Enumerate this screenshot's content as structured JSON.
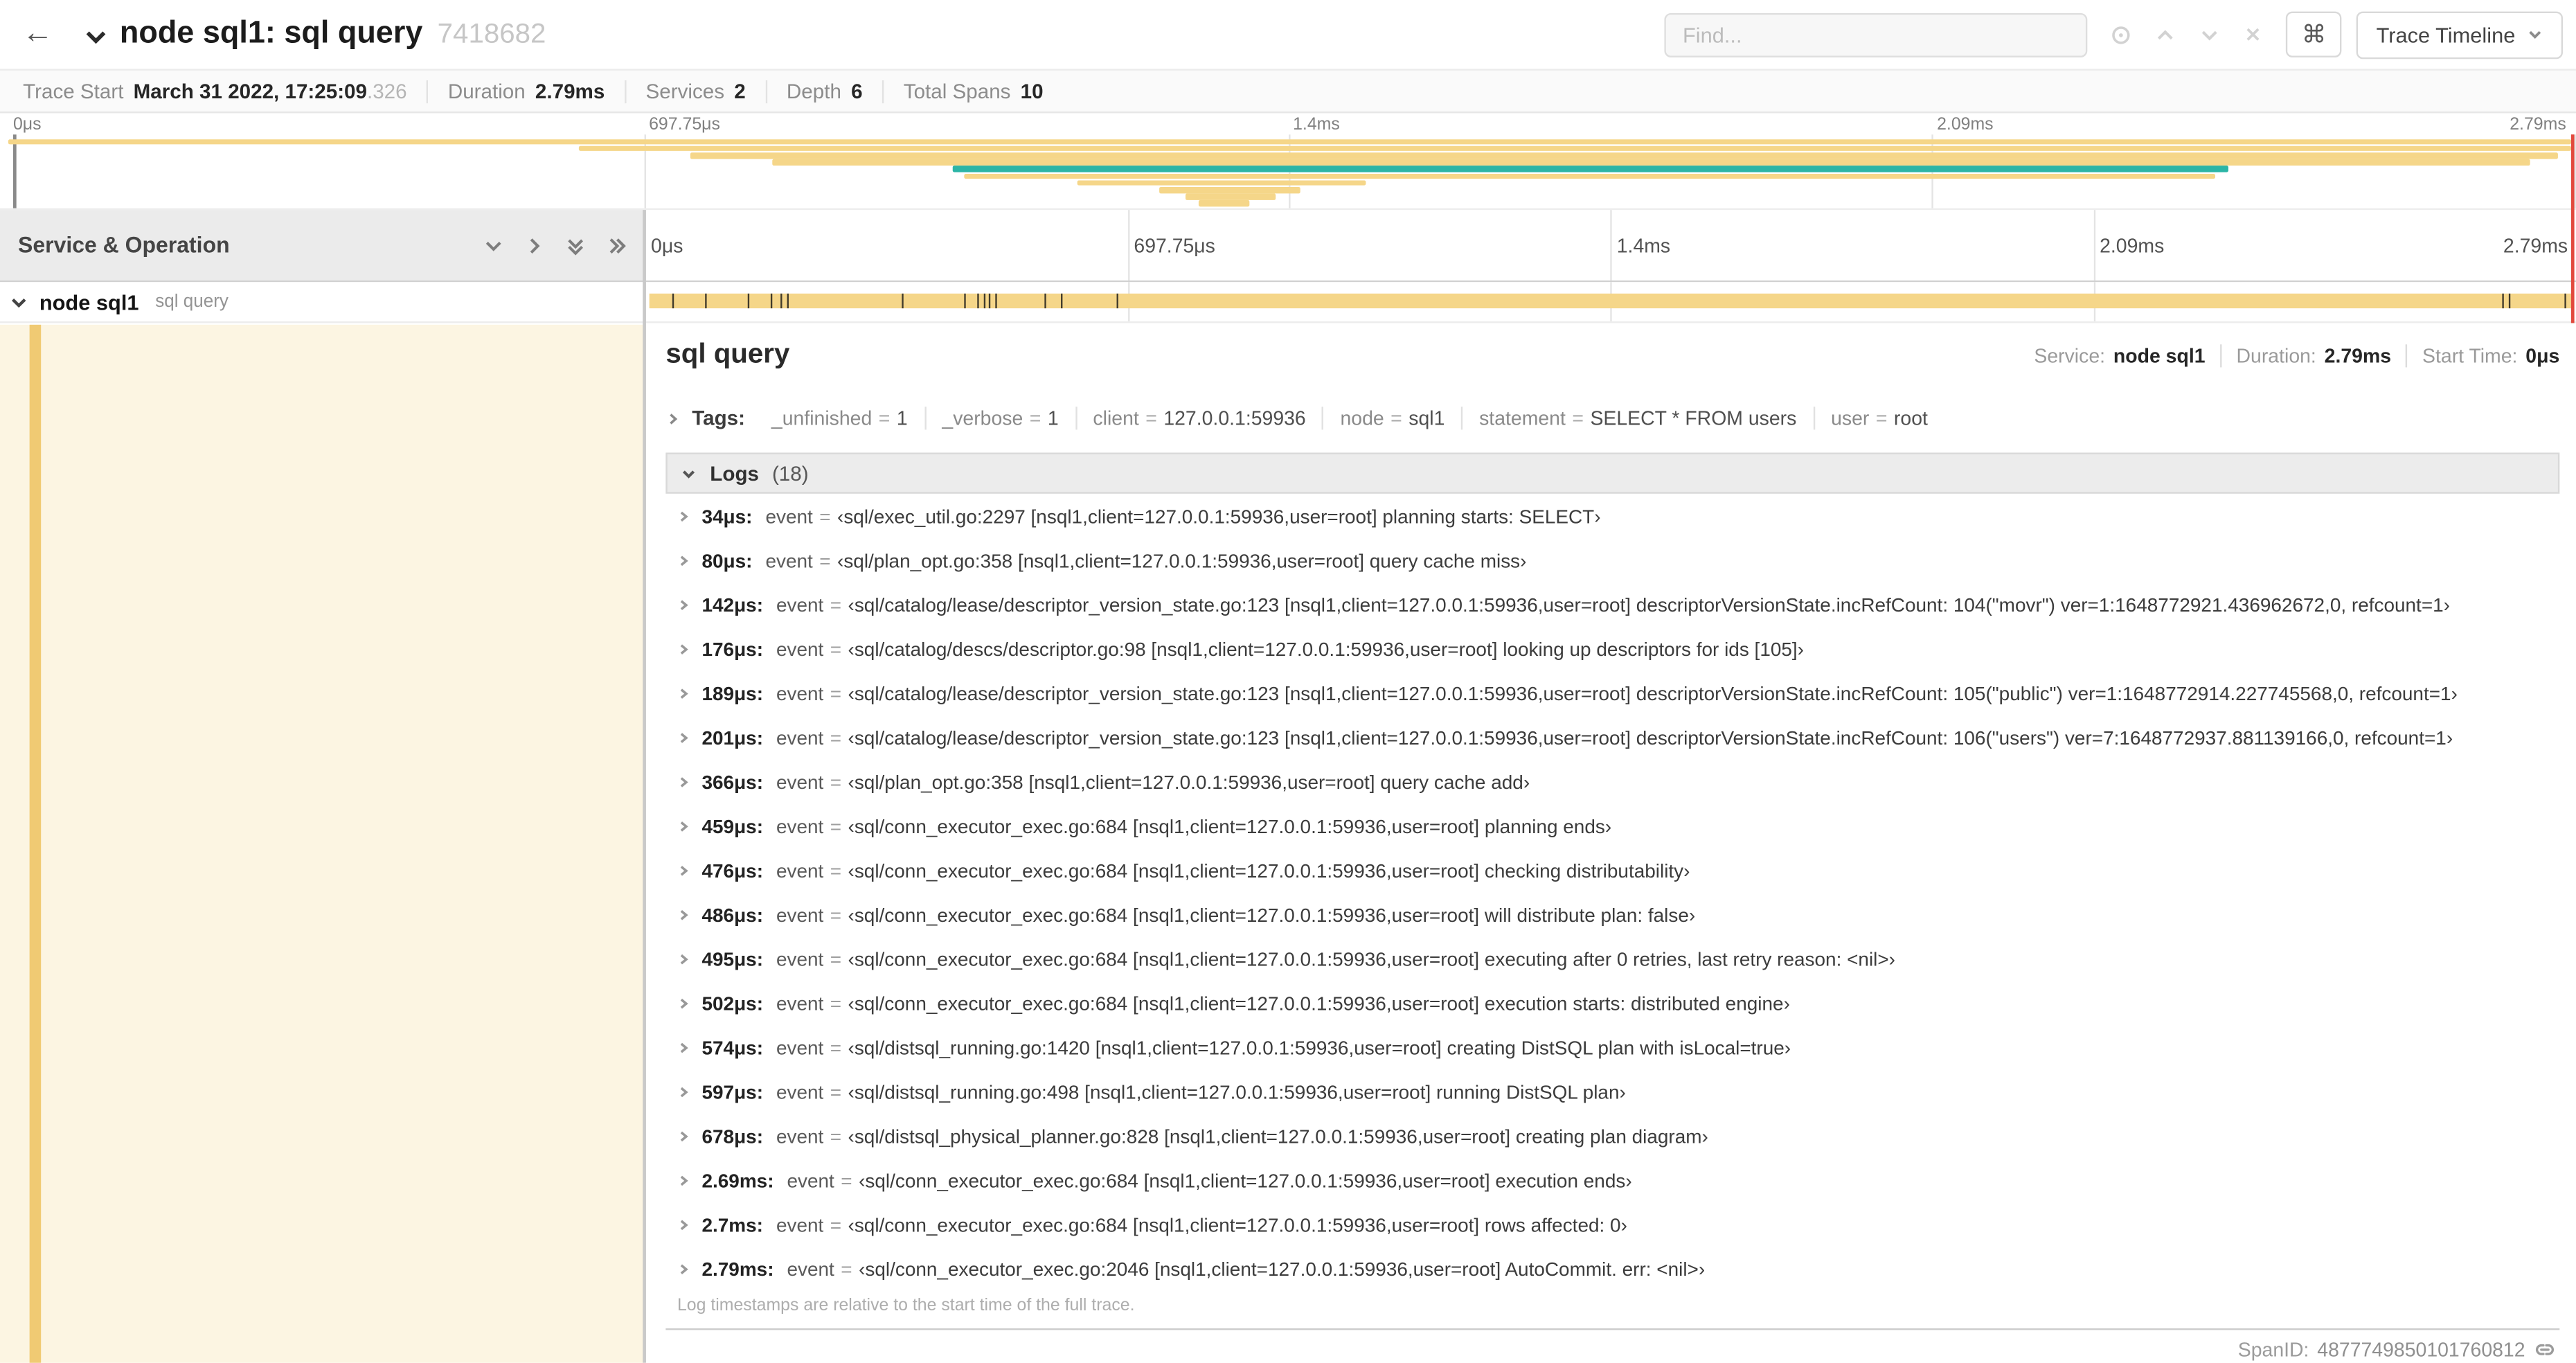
{
  "header": {
    "back_icon": "←",
    "title": "node sql1: sql query",
    "trace_id": "7418682",
    "find": {
      "placeholder": "Find..."
    },
    "shortcut_glyph": "⌘",
    "view_button": "Trace Timeline"
  },
  "summary": [
    {
      "label": "Trace Start",
      "value": "March 31 2022, 17:25:09",
      "suffix": ".326"
    },
    {
      "label": "Duration",
      "value": "2.79ms"
    },
    {
      "label": "Services",
      "value": "2"
    },
    {
      "label": "Depth",
      "value": "6"
    },
    {
      "label": "Total Spans",
      "value": "10"
    }
  ],
  "ticks": [
    "0μs",
    "697.75μs",
    "1.4ms",
    "2.09ms",
    "2.79ms"
  ],
  "colors": {
    "span_tan": "#f5d689",
    "span_teal": "#2bb5a6",
    "scrubber_red": "#e2493d",
    "selected_row_bg": "#fcf5e2"
  },
  "minimap": {
    "spans": [
      {
        "start": 0.3,
        "end": 99.8,
        "color": "#f5d689"
      },
      {
        "start": 22.5,
        "end": 99.8,
        "color": "#f5d689"
      },
      {
        "start": 26.8,
        "end": 99.3,
        "color": "#f5d689"
      },
      {
        "start": 30.0,
        "end": 98.2,
        "color": "#f5d689"
      },
      {
        "start": 37.0,
        "end": 86.5,
        "color": "#2bb5a6"
      },
      {
        "start": 37.4,
        "end": 86.0,
        "color": "#f5d689"
      },
      {
        "start": 41.8,
        "end": 53.0,
        "color": "#f5d689"
      },
      {
        "start": 45.0,
        "end": 50.5,
        "color": "#f5d689"
      },
      {
        "start": 46.0,
        "end": 49.5,
        "color": "#f5d689"
      },
      {
        "start": 46.5,
        "end": 48.5,
        "color": "#f5d689"
      }
    ]
  },
  "timeline": {
    "left_header": "Service & Operation",
    "row": {
      "service": "node sql1",
      "operation": "sql query",
      "color": "#f5d689",
      "events_pct": [
        1.2,
        2.9,
        5.1,
        6.3,
        6.8,
        7.2,
        13.1,
        16.4,
        17.1,
        17.4,
        17.7,
        18.0,
        20.6,
        21.4,
        24.3,
        96.4,
        96.8,
        99.7
      ]
    }
  },
  "detail": {
    "title": "sql query",
    "meta": [
      {
        "label": "Service:",
        "value": "node sql1"
      },
      {
        "label": "Duration:",
        "value": "2.79ms"
      },
      {
        "label": "Start Time:",
        "value": "0μs"
      }
    ],
    "tags_label": "Tags:",
    "eq": "=",
    "tags": [
      {
        "key": "_unfinished",
        "value": "1"
      },
      {
        "key": "_verbose",
        "value": "1"
      },
      {
        "key": "client",
        "value": "127.0.0.1:59936"
      },
      {
        "key": "node",
        "value": "sql1"
      },
      {
        "key": "statement",
        "value": "SELECT * FROM users"
      },
      {
        "key": "user",
        "value": "root"
      }
    ],
    "logs_label": "Logs",
    "logs_count": "(18)",
    "logs": [
      {
        "time": "34μs:",
        "field": "event",
        "value": "‹sql/exec_util.go:2297 [nsql1,client=127.0.0.1:59936,user=root] planning starts: SELECT›"
      },
      {
        "time": "80μs:",
        "field": "event",
        "value": "‹sql/plan_opt.go:358 [nsql1,client=127.0.0.1:59936,user=root] query cache miss›"
      },
      {
        "time": "142μs:",
        "field": "event",
        "value": "‹sql/catalog/lease/descriptor_version_state.go:123 [nsql1,client=127.0.0.1:59936,user=root] descriptorVersionState.incRefCount: 104(\"movr\") ver=1:1648772921.436962672,0, refcount=1›"
      },
      {
        "time": "176μs:",
        "field": "event",
        "value": "‹sql/catalog/descs/descriptor.go:98 [nsql1,client=127.0.0.1:59936,user=root] looking up descriptors for ids [105]›"
      },
      {
        "time": "189μs:",
        "field": "event",
        "value": "‹sql/catalog/lease/descriptor_version_state.go:123 [nsql1,client=127.0.0.1:59936,user=root] descriptorVersionState.incRefCount: 105(\"public\") ver=1:1648772914.227745568,0, refcount=1›"
      },
      {
        "time": "201μs:",
        "field": "event",
        "value": "‹sql/catalog/lease/descriptor_version_state.go:123 [nsql1,client=127.0.0.1:59936,user=root] descriptorVersionState.incRefCount: 106(\"users\") ver=7:1648772937.881139166,0, refcount=1›"
      },
      {
        "time": "366μs:",
        "field": "event",
        "value": "‹sql/plan_opt.go:358 [nsql1,client=127.0.0.1:59936,user=root] query cache add›"
      },
      {
        "time": "459μs:",
        "field": "event",
        "value": "‹sql/conn_executor_exec.go:684 [nsql1,client=127.0.0.1:59936,user=root] planning ends›"
      },
      {
        "time": "476μs:",
        "field": "event",
        "value": "‹sql/conn_executor_exec.go:684 [nsql1,client=127.0.0.1:59936,user=root] checking distributability›"
      },
      {
        "time": "486μs:",
        "field": "event",
        "value": "‹sql/conn_executor_exec.go:684 [nsql1,client=127.0.0.1:59936,user=root] will distribute plan: false›"
      },
      {
        "time": "495μs:",
        "field": "event",
        "value": "‹sql/conn_executor_exec.go:684 [nsql1,client=127.0.0.1:59936,user=root] executing after 0 retries, last retry reason: <nil>›"
      },
      {
        "time": "502μs:",
        "field": "event",
        "value": "‹sql/conn_executor_exec.go:684 [nsql1,client=127.0.0.1:59936,user=root] execution starts: distributed engine›"
      },
      {
        "time": "574μs:",
        "field": "event",
        "value": "‹sql/distsql_running.go:1420 [nsql1,client=127.0.0.1:59936,user=root] creating DistSQL plan with isLocal=true›"
      },
      {
        "time": "597μs:",
        "field": "event",
        "value": "‹sql/distsql_running.go:498 [nsql1,client=127.0.0.1:59936,user=root] running DistSQL plan›"
      },
      {
        "time": "678μs:",
        "field": "event",
        "value": "‹sql/distsql_physical_planner.go:828 [nsql1,client=127.0.0.1:59936,user=root] creating plan diagram›"
      },
      {
        "time": "2.69ms:",
        "field": "event",
        "value": "‹sql/conn_executor_exec.go:684 [nsql1,client=127.0.0.1:59936,user=root] execution ends›"
      },
      {
        "time": "2.7ms:",
        "field": "event",
        "value": "‹sql/conn_executor_exec.go:684 [nsql1,client=127.0.0.1:59936,user=root] rows affected: 0›"
      },
      {
        "time": "2.79ms:",
        "field": "event",
        "value": "‹sql/conn_executor_exec.go:2046 [nsql1,client=127.0.0.1:59936,user=root] AutoCommit. err: <nil>›"
      }
    ],
    "footnote": "Log timestamps are relative to the start time of the full trace.",
    "span_id_label": "SpanID:",
    "span_id": "4877749850101760812"
  }
}
